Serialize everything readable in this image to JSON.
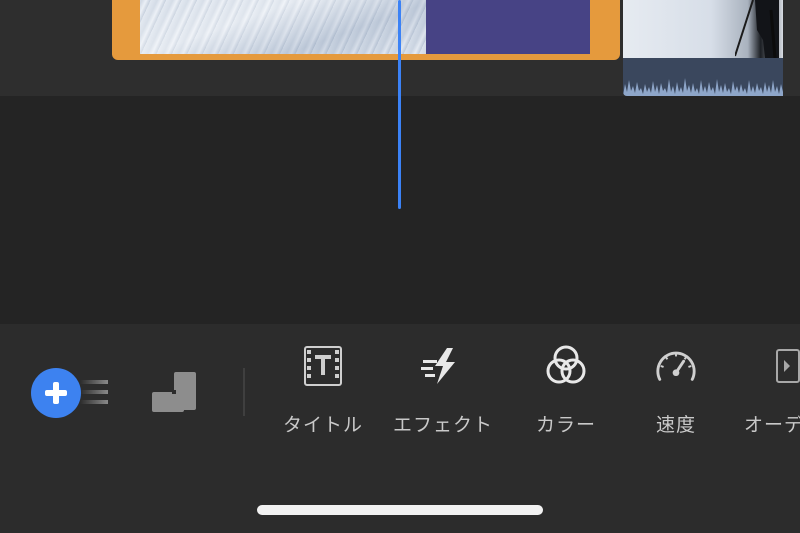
{
  "toolbar": {
    "tools": [
      {
        "id": "title",
        "label": "タイトル",
        "icon": "title-film-icon"
      },
      {
        "id": "effect",
        "label": "エフェクト",
        "icon": "effect-bolt-icon"
      },
      {
        "id": "color",
        "label": "カラー",
        "icon": "color-circles-icon"
      },
      {
        "id": "speed",
        "label": "速度",
        "icon": "speedometer-icon"
      },
      {
        "id": "audio",
        "label": "オーデ",
        "icon": "audio-icon"
      }
    ]
  },
  "colors": {
    "accent": "#3d82f0",
    "selected_clip": "#e59a3d",
    "playhead": "#3b82f6"
  }
}
